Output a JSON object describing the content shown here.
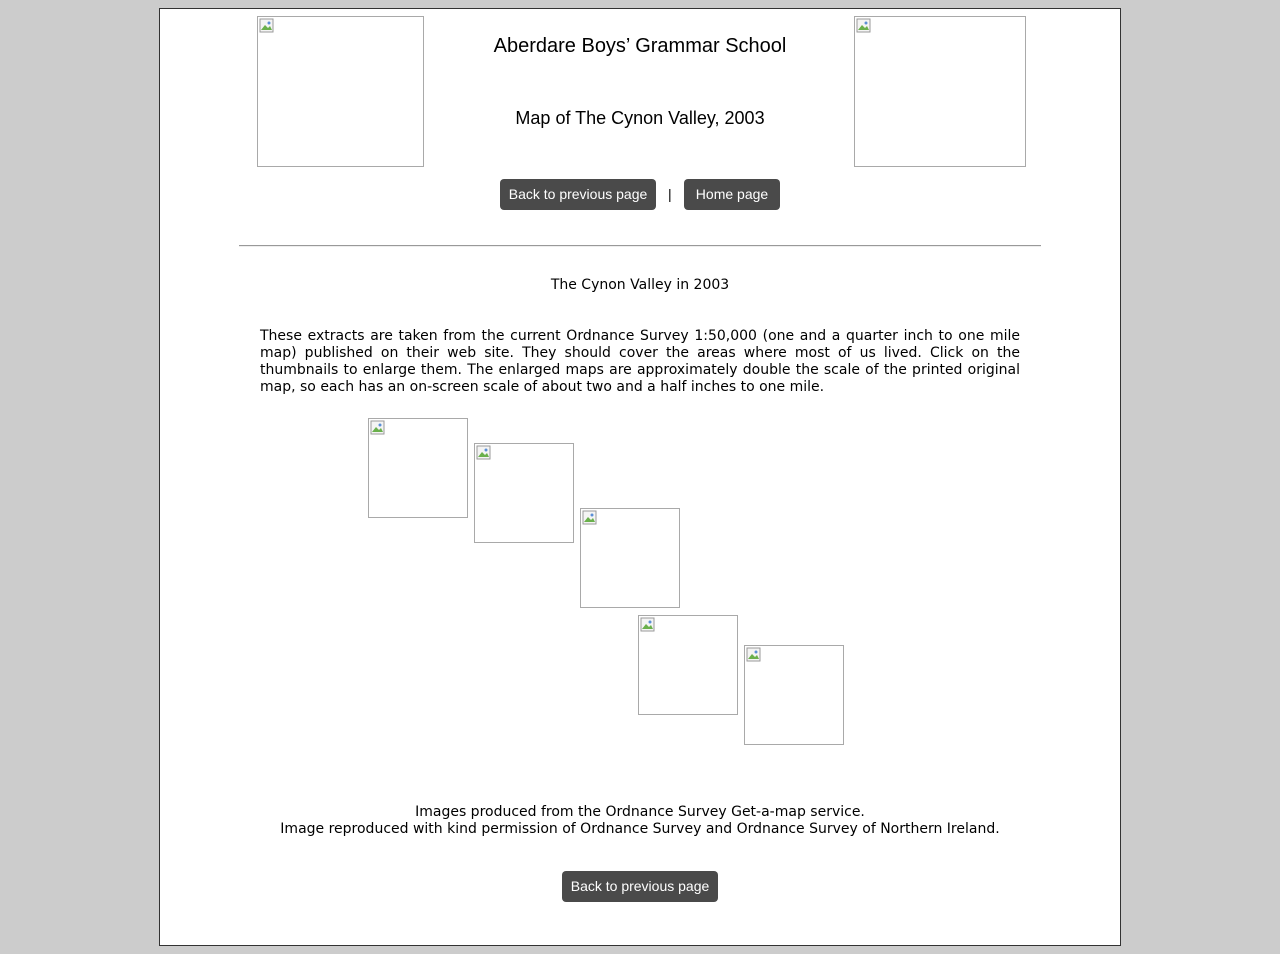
{
  "header": {
    "school_name": "Aberdare Boys’ Grammar School",
    "page_title": "Map of The Cynon Valley, 2003"
  },
  "nav": {
    "back_label": "Back to previous page",
    "separator": "|",
    "home_label": "Home page"
  },
  "content": {
    "heading": "The Cynon Valley in 2003",
    "intro": "These extracts are taken from the current Ordnance Survey 1:50,000 (one and a quarter inch to one mile map) published on their web site. They should cover the areas where most of us lived. Click on the thumbnails to enlarge them. The enlarged maps are approximately double the scale of the printed original map, so each has an on-screen scale of about two and a half inches to one mile.",
    "thumbnail_count": 5
  },
  "footer": {
    "credit_line1": "Images produced from the Ordnance Survey Get-a-map service.",
    "credit_line2": "Image reproduced with kind permission of Ordnance Survey and Ordnance Survey of Northern Ireland.",
    "back_label": "Back to previous page"
  },
  "colors": {
    "page_background": "#cccccc",
    "content_background": "#ffffff",
    "button_background": "#4a4a4a",
    "button_text": "#ffffff"
  }
}
